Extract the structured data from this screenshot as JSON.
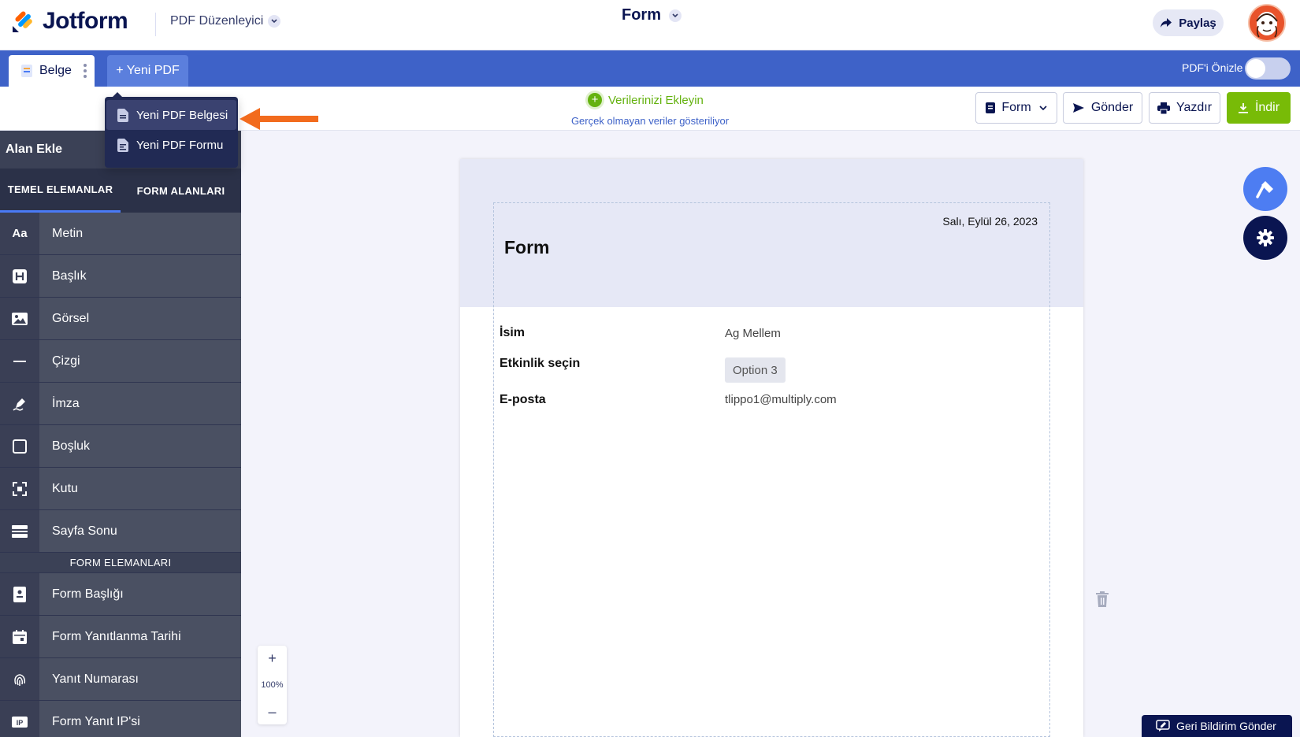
{
  "header": {
    "logo_text": "Jotform",
    "app_switcher": "PDF Düzenleyici",
    "form_title": "Form",
    "share_label": "Paylaş"
  },
  "tabs": {
    "document_tab": "Belge",
    "new_pdf_tab": "+ Yeni PDF",
    "preview_label": "PDF'i Önizle",
    "preview_toggle_on": false
  },
  "dropdown": {
    "items": [
      {
        "label": "Yeni PDF Belgesi",
        "active": true
      },
      {
        "label": "Yeni PDF Formu",
        "active": false
      }
    ]
  },
  "actionbar": {
    "add_data": "Verilerinizi Ekleyin",
    "fake_data_note": "Gerçek olmayan veriler gösteriliyor",
    "form_button": "Form",
    "send_button": "Gönder",
    "print_button": "Yazdır",
    "download_button": "İndir"
  },
  "sidebar": {
    "title": "Alan Ekle",
    "tab_basic": "TEMEL ELEMANLAR",
    "tab_form": "FORM ALANLARI",
    "basic_items": [
      {
        "label": "Metin",
        "icon": "text-icon"
      },
      {
        "label": "Başlık",
        "icon": "heading-icon"
      },
      {
        "label": "Görsel",
        "icon": "image-icon"
      },
      {
        "label": "Çizgi",
        "icon": "line-icon"
      },
      {
        "label": "İmza",
        "icon": "signature-icon"
      },
      {
        "label": "Boşluk",
        "icon": "spacer-icon"
      },
      {
        "label": "Kutu",
        "icon": "box-icon"
      },
      {
        "label": "Sayfa Sonu",
        "icon": "page-break-icon"
      }
    ],
    "section_title": "FORM ELEMANLARI",
    "form_items": [
      {
        "label": "Form Başlığı",
        "icon": "form-title-icon"
      },
      {
        "label": "Form Yanıtlanma Tarihi",
        "icon": "calendar-icon"
      },
      {
        "label": "Yanıt Numarası",
        "icon": "fingerprint-icon"
      },
      {
        "label": "Form Yanıt IP'si",
        "icon": "ip-icon"
      }
    ]
  },
  "zoom": {
    "plus": "+",
    "value": "100%",
    "minus": "–"
  },
  "page": {
    "date": "Salı, Eylül 26, 2023",
    "title": "Form",
    "fields": [
      {
        "label": "İsim",
        "value": "Ag Mellem"
      },
      {
        "label": "Etkinlik seçin",
        "value": "Option 3"
      },
      {
        "label": "E-posta",
        "value": "tlippo1@multiply.com"
      }
    ]
  },
  "feedback_label": "Geri Bildirim Gönder",
  "colors": {
    "brand_navy": "#0a1551",
    "tab_bar_blue": "#3e62c8",
    "download_green": "#78bb07",
    "add_data_green": "#64b20f",
    "annotation_arrow": "#f26b1d"
  }
}
